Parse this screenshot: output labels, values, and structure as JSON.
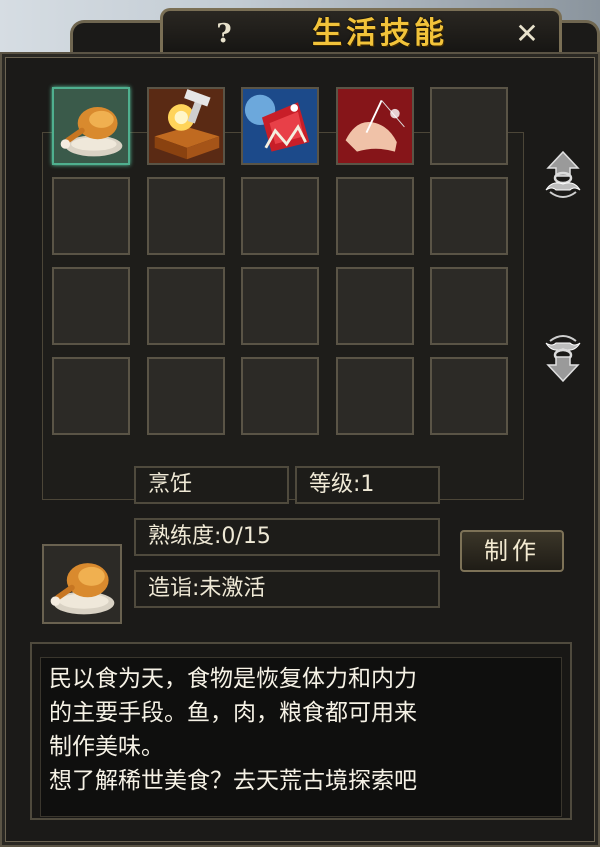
{
  "window": {
    "title": "生活技能",
    "help_label": "?",
    "close_label": "✕"
  },
  "slots": [
    {
      "icon": "roast-chicken-icon",
      "active": true
    },
    {
      "icon": "forging-hammer-icon",
      "active": false
    },
    {
      "icon": "tailoring-cloth-icon",
      "active": false
    },
    {
      "icon": "sewing-hand-icon",
      "active": false
    },
    {
      "icon": "",
      "active": false
    },
    {
      "icon": "",
      "active": false
    },
    {
      "icon": "",
      "active": false
    },
    {
      "icon": "",
      "active": false
    },
    {
      "icon": "",
      "active": false
    },
    {
      "icon": "",
      "active": false
    },
    {
      "icon": "",
      "active": false
    },
    {
      "icon": "",
      "active": false
    },
    {
      "icon": "",
      "active": false
    },
    {
      "icon": "",
      "active": false
    },
    {
      "icon": "",
      "active": false
    },
    {
      "icon": "",
      "active": false
    },
    {
      "icon": "",
      "active": false
    },
    {
      "icon": "",
      "active": false
    },
    {
      "icon": "",
      "active": false
    },
    {
      "icon": "",
      "active": false
    }
  ],
  "skill": {
    "icon": "roast-chicken-icon",
    "name": "烹饪",
    "level": "等级:1",
    "proficiency": "熟练度:0/15",
    "mastery": "造诣:未激活",
    "craft_label": "制作"
  },
  "description": "民以食为天，食物是恢复体力和内力\n的主要手段。鱼，肉，粮食都可用来\n制作美味。\n想了解稀世美食？去天荒古境探索吧",
  "colors": {
    "title": "#f2c33a",
    "active_slot_border": "#4fb08f",
    "panel_bg": "#1b1a18"
  }
}
